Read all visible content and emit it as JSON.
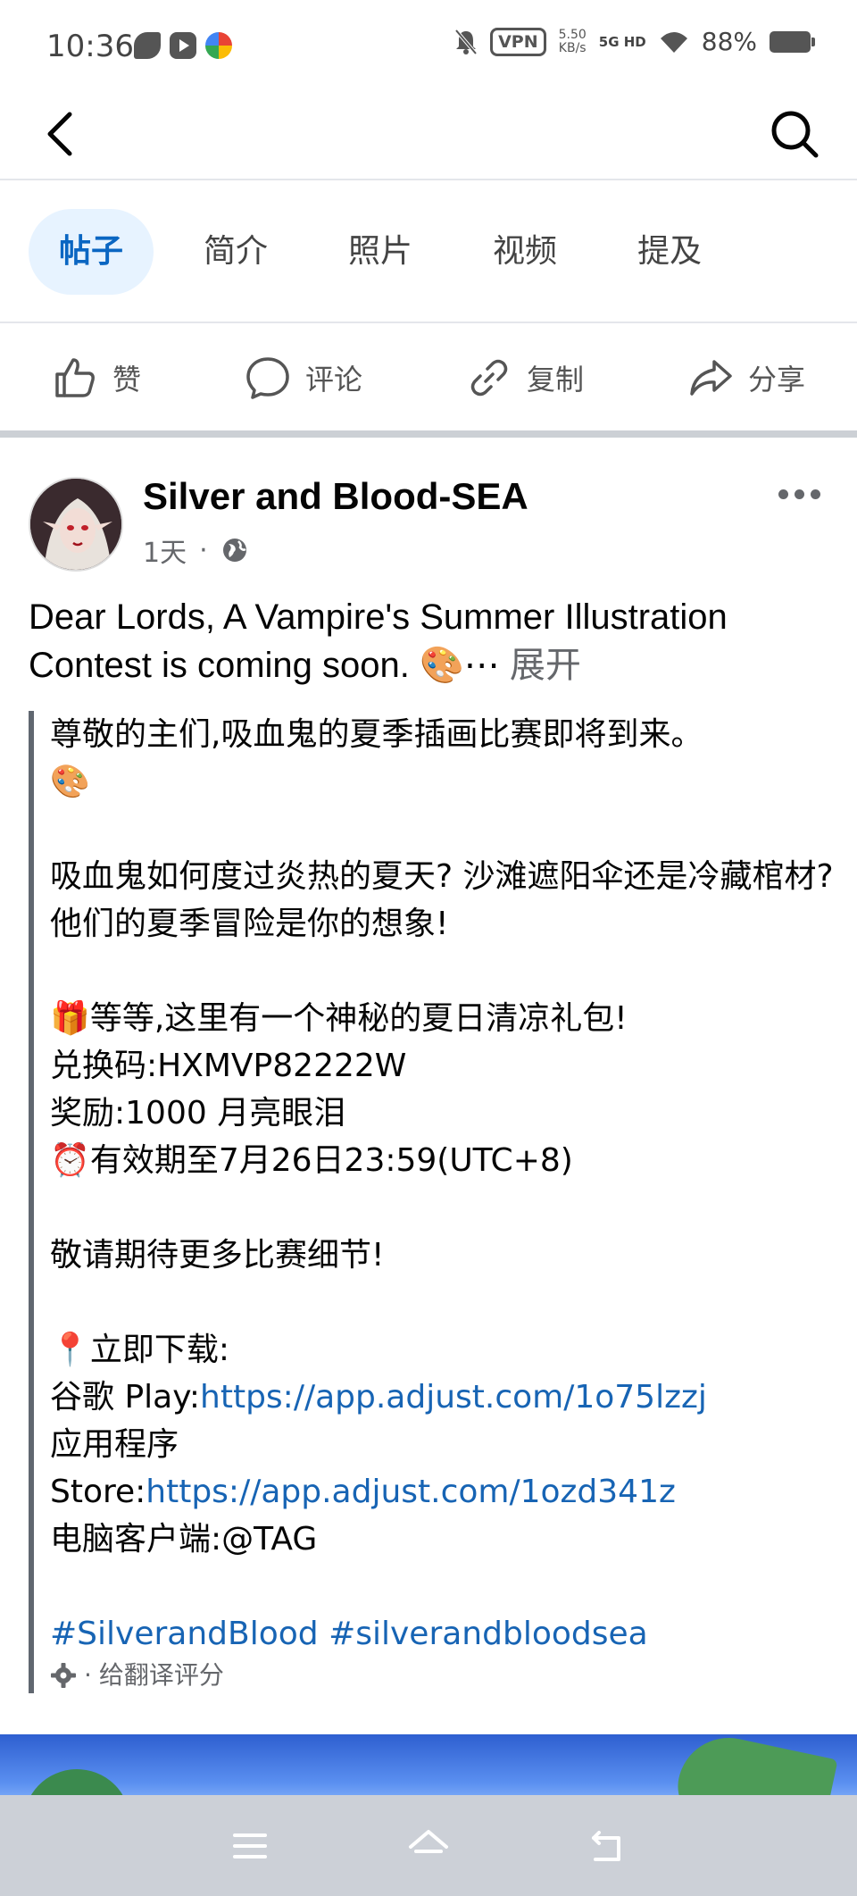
{
  "status_bar": {
    "time": "10:36",
    "vpn": "VPN",
    "speed_value": "5.50",
    "speed_unit": "KB/s",
    "signal": "5G HD",
    "battery": "88%"
  },
  "tabs": [
    {
      "label": "帖子",
      "active": true
    },
    {
      "label": "简介",
      "active": false
    },
    {
      "label": "照片",
      "active": false
    },
    {
      "label": "视频",
      "active": false
    },
    {
      "label": "提及",
      "active": false
    }
  ],
  "actions": {
    "like": "赞",
    "comment": "评论",
    "copy": "复制",
    "share": "分享"
  },
  "post": {
    "author": "Silver and Blood-SEA",
    "time": "1天",
    "dot": "·",
    "text": "Dear Lords, A Vampire's Summer Illustration Contest is coming soon. 🎨⋯",
    "see_more": "展开",
    "translation": {
      "line1": "尊敬的主们,吸血鬼的夏季插画比赛即将到来。",
      "line2": "🎨",
      "line3": "吸血鬼如何度过炎热的夏天? 沙滩遮阳伞还是冷藏棺材? 他们的夏季冒险是你的想象!",
      "line4": "🎁等等,这里有一个神秘的夏日清凉礼包!",
      "line5": "兑换码:HXMVP82222W",
      "line6": "奖励:1000 月亮眼泪",
      "line7": "⏰有效期至7月26日23:59(UTC+8)",
      "line8": "敬请期待更多比赛细节!",
      "line9": "📍立即下载:",
      "google_prefix": "谷歌 Play:",
      "google_link": "https://app.adjust.com/1o75lzzj",
      "store_prefix_line": "应用程序",
      "store_prefix": "Store:",
      "store_link": "https://app.adjust.com/1ozd341z",
      "pc_line": "电脑客户端:@TAG",
      "hashtag1": "#SilverandBlood",
      "hashtag2": "#silverandbloodsea",
      "rate_dot": "·",
      "rate_label": "给翻译评分"
    }
  }
}
